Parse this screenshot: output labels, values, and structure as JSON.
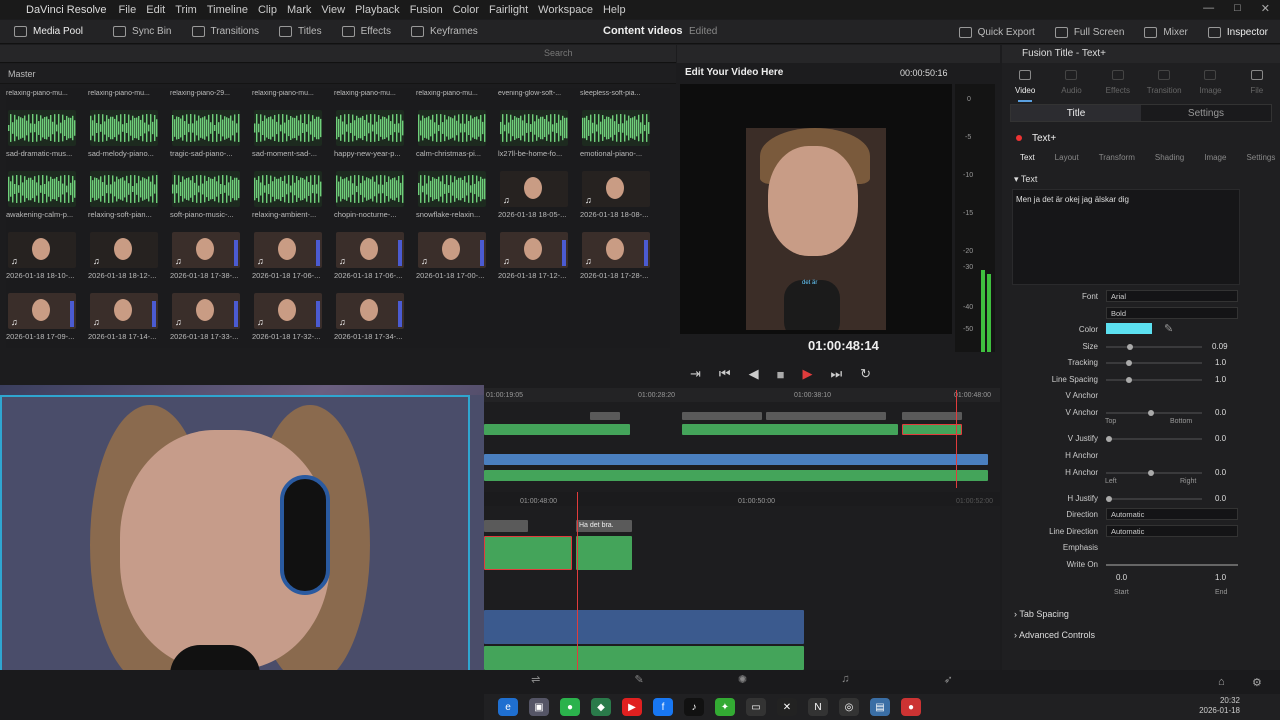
{
  "app": {
    "name": "DaVinci Resolve"
  },
  "menu": [
    "File",
    "Edit",
    "Trim",
    "Timeline",
    "Clip",
    "Mark",
    "View",
    "Playback",
    "Fusion",
    "Color",
    "Fairlight",
    "Workspace",
    "Help"
  ],
  "toolbar": {
    "media_pool": "Media Pool",
    "sync_bin": "Sync Bin",
    "transitions": "Transitions",
    "titles": "Titles",
    "effects": "Effects",
    "keyframes": "Keyframes",
    "project_title": "Content videos",
    "edited": "Edited",
    "quick_export": "Quick Export",
    "full_screen": "Full Screen",
    "mixer": "Mixer",
    "inspector": "Inspector"
  },
  "media_pool": {
    "search_placeholder": "Search",
    "bin": "Master",
    "top_row": [
      "relaxing-piano-mu...",
      "relaxing-piano-mu...",
      "relaxing-piano-29...",
      "relaxing-piano-mu...",
      "relaxing-piano-mu...",
      "relaxing-piano-mu...",
      "evening-glow-soft-...",
      "sleepless-soft-pia..."
    ],
    "rows": [
      [
        "sad-dramatic-mus...",
        "sad-melody-piano...",
        "tragic-sad-piano-...",
        "sad-moment-sad-...",
        "happy-new-year-p...",
        "calm-christmas-pi...",
        "lx27ll-be-home-fo...",
        "emotional-piano-..."
      ],
      [
        "awakening-calm-p...",
        "relaxing-soft-pian...",
        "soft-piano-music-...",
        "relaxing-ambient-...",
        "chopin-nocturne-...",
        "snowflake-relaxin...",
        "2026-01-18 18-05-...",
        "2026-01-18 18-08-..."
      ],
      [
        "2026-01-18 18-10-...",
        "2026-01-18 18-12-...",
        "2026-01-18 17-38-...",
        "2026-01-18 17-06-...",
        "2026-01-18 17-06-...",
        "2026-01-18 17-00-...",
        "2026-01-18 17-12-...",
        "2026-01-18 17-28-..."
      ],
      [
        "2026-01-18 17-09-...",
        "2026-01-18 17-14-...",
        "2026-01-18 17-33-...",
        "2026-01-18 17-32-...",
        "2026-01-18 17-34-..."
      ]
    ]
  },
  "viewer": {
    "title": "Edit Your Video Here",
    "duration_tc": "00:00:50:16",
    "current_tc": "01:00:48:14",
    "meter_ticks": [
      "0",
      "-5",
      "-10",
      "-15",
      "-20",
      "-30",
      "-40",
      "-50"
    ],
    "subtitle_overlay": "det är"
  },
  "timeline": {
    "ruler_top": [
      "01:00:19:05",
      "01:00:28:20",
      "01:00:38:10",
      "01:00:48:00"
    ],
    "ruler_zoom": [
      "01:00:48:00",
      "01:00:50:00",
      "01:00:52:00"
    ],
    "title_clip": "Ha det bra."
  },
  "inspector": {
    "panel_title": "Fusion Title - Text+",
    "tabs": [
      "Video",
      "Audio",
      "Effects",
      "Transition",
      "Image",
      "File"
    ],
    "segments": [
      "Title",
      "Settings"
    ],
    "node": "Text+",
    "subtabs": [
      "Text",
      "Layout",
      "Transform",
      "Shading",
      "Image",
      "Settings"
    ],
    "section_text": "Text",
    "text_value": "Men ja det är okej jag älskar dig",
    "font_label": "Font",
    "font": "Arial",
    "style": "Bold",
    "color_label": "Color",
    "color_value": "#5ce0f0",
    "size_label": "Size",
    "size": "0.09",
    "size_fraction": 0.09,
    "tracking_label": "Tracking",
    "tracking": "1.0",
    "line_spacing_label": "Line Spacing",
    "line_spacing": "1.0",
    "v_anchor_label": "V Anchor",
    "v_anchor2_label": "V Anchor",
    "v_anchor_val": "0.0",
    "top": "Top",
    "bottom": "Bottom",
    "v_justify_label": "V Justify",
    "v_justify": "0.0",
    "h_anchor_label": "H Anchor",
    "h_anchor2_label": "H Anchor",
    "h_anchor_val": "0.0",
    "left": "Left",
    "right": "Right",
    "h_justify_label": "H Justify",
    "h_justify": "0.0",
    "direction_label": "Direction",
    "direction": "Automatic",
    "line_direction_label": "Line Direction",
    "line_direction": "Automatic",
    "emphasis_label": "Emphasis",
    "write_on_label": "Write On",
    "write_on_start": "0.0",
    "write_on_end": "1.0",
    "start": "Start",
    "end": "End",
    "tab_spacing": "Tab Spacing",
    "advanced_controls": "Advanced Controls"
  },
  "taskbar": {
    "time": "20:32",
    "date": "2026-01-18"
  },
  "colors": {
    "accent": "#5aa0e0",
    "clip_green": "#44a45a",
    "clip_blue": "#4a7fbf",
    "playhead": "#e03c3c"
  }
}
